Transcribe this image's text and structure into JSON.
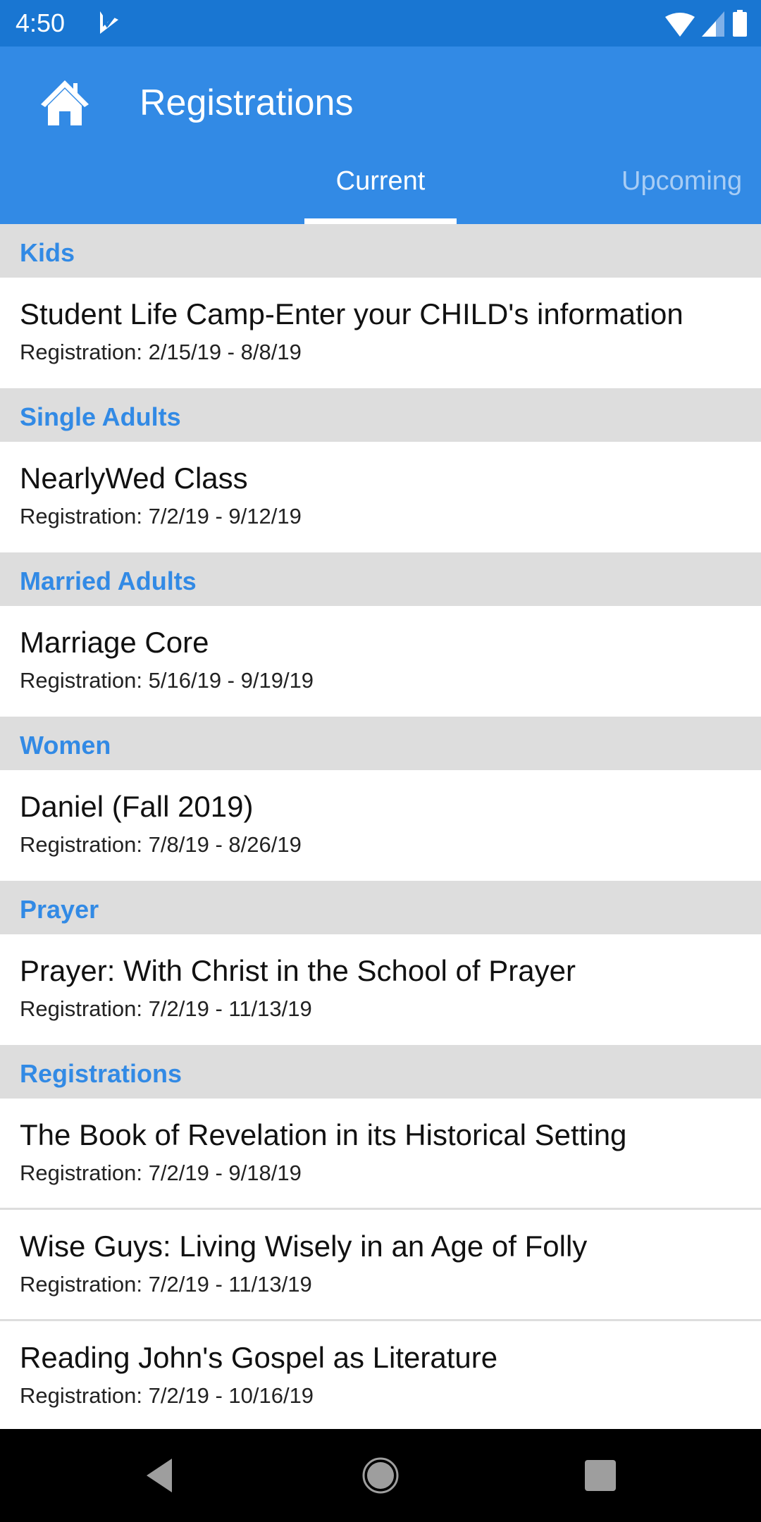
{
  "status_bar": {
    "time": "4:50",
    "icons": [
      "notification-check-icon",
      "wifi-icon",
      "signal-icon",
      "battery-icon"
    ]
  },
  "app_bar": {
    "title": "Registrations",
    "home_icon": "home-icon",
    "colors": {
      "primary": "#328ae5",
      "status": "#1976d2"
    }
  },
  "tabs": [
    {
      "label": "Current",
      "selected": true
    },
    {
      "label": "Upcoming",
      "selected": false
    }
  ],
  "sections": [
    {
      "header": "Kids",
      "items": [
        {
          "title": "Student Life Camp-Enter your CHILD's information",
          "subtitle": "Registration: 2/15/19 - 8/8/19"
        }
      ]
    },
    {
      "header": "Single Adults",
      "items": [
        {
          "title": "NearlyWed Class",
          "subtitle": "Registration: 7/2/19 - 9/12/19"
        }
      ]
    },
    {
      "header": "Married Adults",
      "items": [
        {
          "title": "Marriage Core",
          "subtitle": "Registration: 5/16/19 - 9/19/19"
        }
      ]
    },
    {
      "header": "Women",
      "items": [
        {
          "title": "Daniel (Fall 2019)",
          "subtitle": "Registration: 7/8/19 - 8/26/19"
        }
      ]
    },
    {
      "header": "Prayer",
      "items": [
        {
          "title": "Prayer: With Christ in the School of Prayer",
          "subtitle": "Registration: 7/2/19 - 11/13/19"
        }
      ]
    },
    {
      "header": "Registrations",
      "items": [
        {
          "title": "The Book of Revelation in its Historical Setting",
          "subtitle": "Registration: 7/2/19 - 9/18/19"
        },
        {
          "title": "Wise Guys: Living Wisely in an Age of Folly",
          "subtitle": "Registration: 7/2/19 - 11/13/19"
        },
        {
          "title": "Reading John's Gospel as Literature",
          "subtitle": "Registration: 7/2/19 - 10/16/19"
        }
      ]
    }
  ],
  "nav_bar": {
    "buttons": [
      "back-icon",
      "home-circle-icon",
      "recents-icon"
    ]
  }
}
